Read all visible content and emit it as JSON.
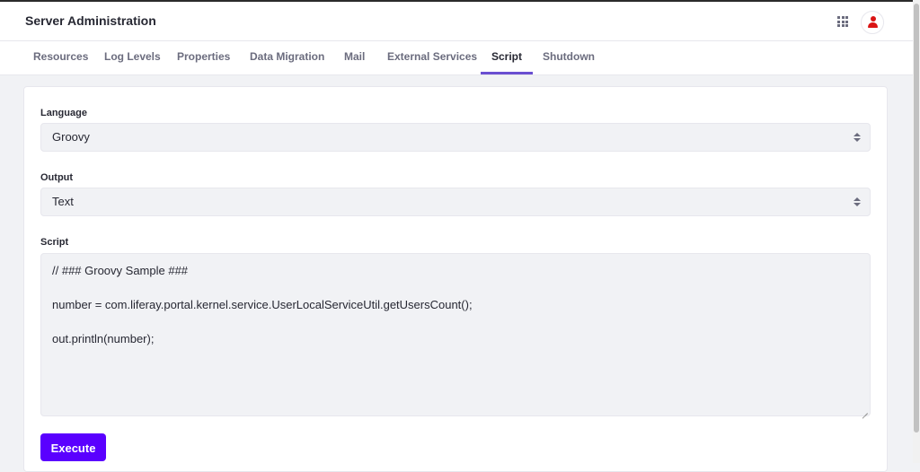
{
  "header": {
    "title": "Server Administration",
    "apps_icon": "apps-grid-icon",
    "avatar_icon": "user-icon",
    "avatar_color": "#da1414"
  },
  "tabs": [
    {
      "label": "Resources",
      "active": false
    },
    {
      "label": "Log Levels",
      "active": false
    },
    {
      "label": "Properties",
      "active": false
    },
    {
      "label": "Data Migration",
      "active": false
    },
    {
      "label": "Mail",
      "active": false
    },
    {
      "label": "External Services",
      "active": false
    },
    {
      "label": "Script",
      "active": true
    },
    {
      "label": "Shutdown",
      "active": false
    }
  ],
  "form": {
    "language": {
      "label": "Language",
      "value": "Groovy"
    },
    "output": {
      "label": "Output",
      "value": "Text"
    },
    "script": {
      "label": "Script",
      "lines": [
        "// ### Groovy Sample ###",
        "",
        "number = com.liferay.portal.kernel.service.UserLocalServiceUtil.getUsersCount();",
        "",
        "out.println(number);"
      ]
    },
    "execute_label": "Execute"
  },
  "colors": {
    "accent": "#5a00ff",
    "tab_indicator": "#6a4fd1"
  }
}
